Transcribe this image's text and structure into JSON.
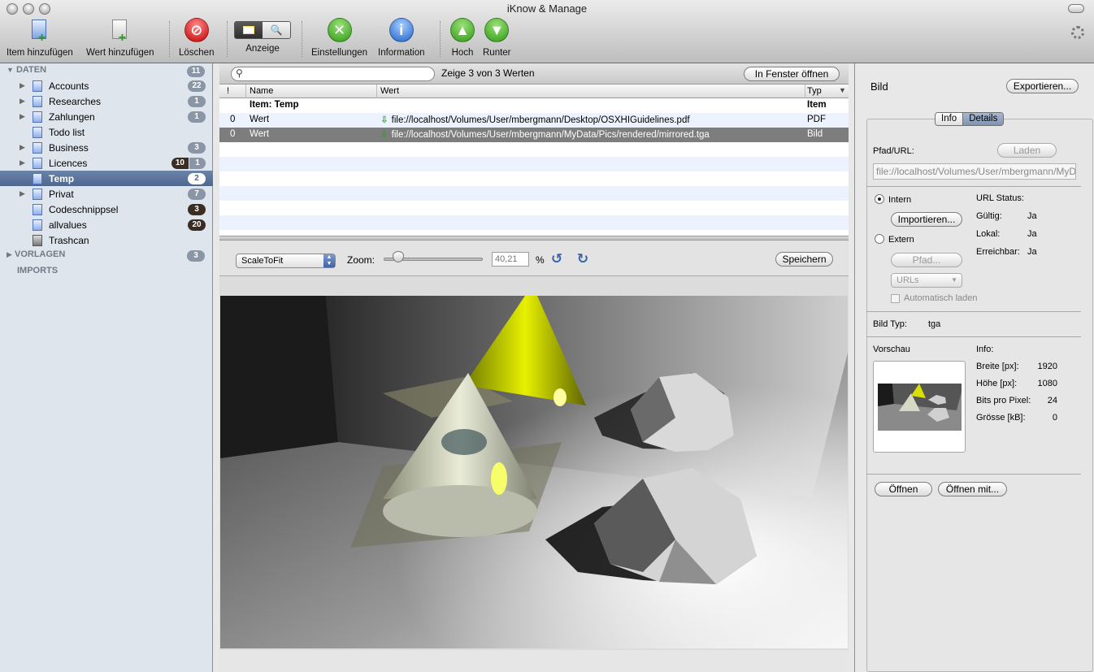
{
  "window": {
    "title": "iKnow & Manage"
  },
  "toolbar": {
    "add_item": "Item hinzufügen",
    "add_value": "Wert hinzufügen",
    "delete": "Löschen",
    "view": "Anzeige",
    "settings": "Einstellungen",
    "information": "Information",
    "up": "Hoch",
    "down": "Runter"
  },
  "sidebar": {
    "groups": {
      "daten": "DATEN",
      "daten_count": "11",
      "vorlagen": "VORLAGEN",
      "vorlagen_count": "3",
      "imports": "IMPORTS"
    },
    "items": [
      {
        "label": "Accounts",
        "count": "22"
      },
      {
        "label": "Researches",
        "count": "1"
      },
      {
        "label": "Zahlungen",
        "count": "1"
      },
      {
        "label": "Todo list",
        "count": ""
      },
      {
        "label": "Business",
        "count": "3"
      },
      {
        "label": "Licences",
        "count": "1",
        "count_extra": "10"
      },
      {
        "label": "Temp",
        "count": "2"
      },
      {
        "label": "Privat",
        "count": "7"
      },
      {
        "label": "Codeschnippsel",
        "count": "3"
      },
      {
        "label": "allvalues",
        "count": "20"
      },
      {
        "label": "Trashcan",
        "count": ""
      }
    ]
  },
  "search": {
    "placeholder": "",
    "status": "Zeige 3 von 3 Werten",
    "open_window": "In Fenster öffnen"
  },
  "table": {
    "columns": [
      "!",
      "Name",
      "Wert",
      "Typ"
    ],
    "rows": [
      {
        "flag": "",
        "name": "Item: Temp",
        "value": "",
        "type": "Item"
      },
      {
        "flag": "0",
        "name": "Wert",
        "value": "file://localhost/Volumes/User/mbergmann/Desktop/OSXHIGuidelines.pdf",
        "type": "PDF"
      },
      {
        "flag": "0",
        "name": "Wert",
        "value": "file://localhost/Volumes/User/mbergmann/MyData/Pics/rendered/mirrored.tga",
        "type": "Bild"
      }
    ]
  },
  "viewer": {
    "scale_mode": "ScaleToFit",
    "zoom_label": "Zoom:",
    "zoom_value": "40,21",
    "percent": "%",
    "save": "Speichern",
    "zoom_level": 0.1
  },
  "detail": {
    "title": "Bild",
    "export": "Exportieren...",
    "tabs": [
      "Info",
      "Details"
    ],
    "active_tab": "Details",
    "path_label": "Pfad/URL:",
    "load": "Laden",
    "url": "file://localhost/Volumes/User/mbergmann/MyData/Pics/rendered/mirrored.tga",
    "intern": "Intern",
    "import": "Importieren...",
    "extern": "Extern",
    "path_btn": "Pfad...",
    "urls": "URLs",
    "auto_load": "Automatisch laden",
    "url_status": "URL Status:",
    "valid_label": "Gültig:",
    "valid": "Ja",
    "local_label": "Lokal:",
    "local": "Ja",
    "reach_label": "Erreichbar:",
    "reach": "Ja",
    "type_label": "Bild Typ:",
    "type": "tga",
    "preview": "Vorschau",
    "info": "Info:",
    "width_label": "Breite [px]:",
    "width": "1920",
    "height_label": "Höhe [px]:",
    "height": "1080",
    "bpp_label": "Bits pro Pixel:",
    "bpp": "24",
    "size_label": "Grösse [kB]:",
    "size": "0",
    "open": "Öffnen",
    "open_with": "Öffnen mit..."
  },
  "colors": {
    "selection": "#5a729a",
    "selected_row": "#7d7d7d",
    "sidebar_bg": "#dfe5ed"
  }
}
